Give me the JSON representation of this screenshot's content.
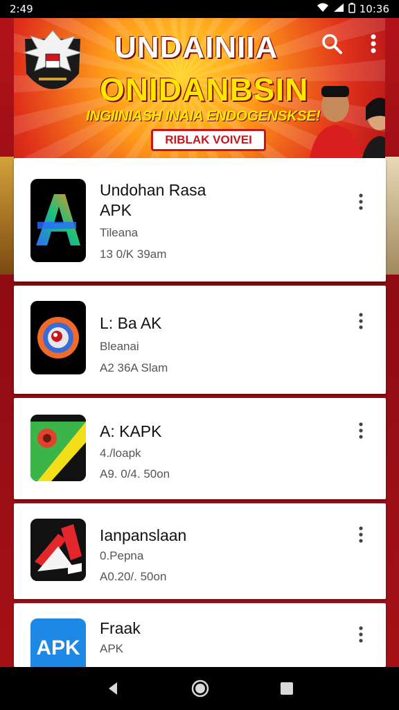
{
  "status_bar": {
    "time": "2:49",
    "clock": "10:36"
  },
  "banner": {
    "title_line1": "UNDAINIIA",
    "title_line2": "ONIDANBSIN",
    "subtitle": "INGIINIASH INAIA ENDOGENSKSE!",
    "button_label": "RIBLAK VOIVEI"
  },
  "apps": [
    {
      "name_line1": "Undohan Rasa",
      "name_line2": "APK",
      "sub": "Tileana",
      "meta": "13 0/K 39am"
    },
    {
      "name_line1": "L: Ba AK",
      "name_line2": "",
      "sub": "Bleanai",
      "meta": "A2 36A Slam"
    },
    {
      "name_line1": "A: KAPK",
      "name_line2": "",
      "sub": "4./loapk",
      "meta": "A9. 0/4. 50on"
    },
    {
      "name_line1": "Ianpanslaan",
      "name_line2": "",
      "sub": "0.Pepna",
      "meta": "A0.20/. 50on"
    },
    {
      "name_line1": "Fraak",
      "name_line2": "",
      "sub": "APK",
      "meta": ""
    }
  ],
  "app_icons": [
    "gradient-a-icon",
    "swirl-icon",
    "map-pin-icon",
    "red-shapes-icon",
    "apk-text-icon"
  ],
  "app_icon_text": "APK",
  "colors": {
    "accent_red": "#b3131a",
    "banner_yellow": "#ffe600",
    "card_bg": "#ffffff"
  },
  "nav": {
    "back": "back-icon",
    "home": "home-icon",
    "recents": "recents-icon"
  }
}
